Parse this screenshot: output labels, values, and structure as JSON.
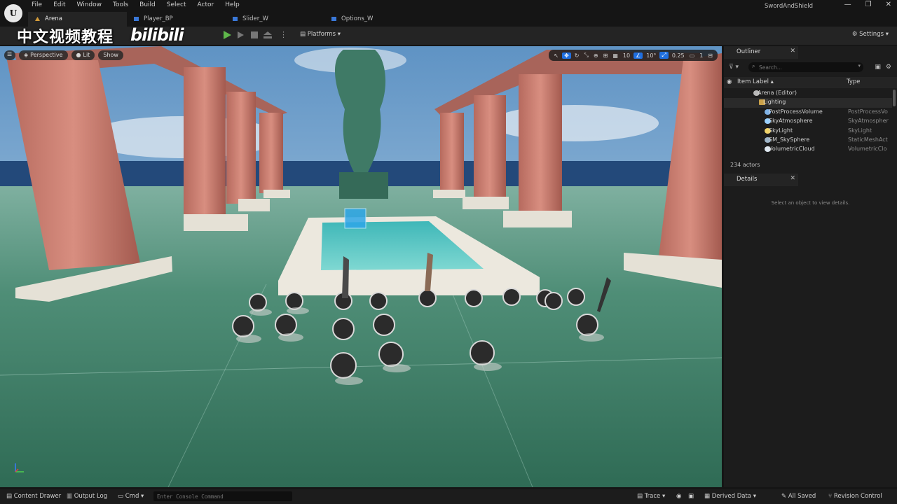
{
  "app": {
    "logo": "U",
    "project_name": "SwordAndShield",
    "window_controls": [
      "—",
      "❐",
      "✕"
    ]
  },
  "menu": [
    "File",
    "Edit",
    "Window",
    "Tools",
    "Build",
    "Select",
    "Actor",
    "Help"
  ],
  "tabs": [
    {
      "label": "Arena",
      "active": true
    },
    {
      "label": "Player_BP",
      "active": false
    },
    {
      "label": "Slider_W",
      "active": false
    },
    {
      "label": "Options_W",
      "active": false
    }
  ],
  "watermark": {
    "text": "中文视频教程",
    "logo": "bilibili"
  },
  "toolbar": {
    "platforms_label": "Platforms",
    "settings_label": "Settings"
  },
  "viewport": {
    "perspective_label": "Perspective",
    "lit_label": "Lit",
    "show_label": "Show",
    "grid_snap": "10",
    "rotation_snap": "10°",
    "scale_snap": "0.25",
    "camera_speed": "1"
  },
  "outliner": {
    "title": "Outliner",
    "search_placeholder": "Search...",
    "col_label": "Item Label ▴",
    "col_type": "Type",
    "rows": [
      {
        "name": "Arena (Editor)",
        "type": "",
        "indent": 44,
        "icon": "world"
      },
      {
        "name": "Lighting",
        "type": "",
        "indent": 52,
        "icon": "folder"
      },
      {
        "name": "PostProcessVolume",
        "type": "PostProcessVo",
        "indent": 60,
        "icon": "volume"
      },
      {
        "name": "SkyAtmosphere",
        "type": "SkyAtmospher",
        "indent": 60,
        "icon": "sky"
      },
      {
        "name": "SkyLight",
        "type": "SkyLight",
        "indent": 60,
        "icon": "light"
      },
      {
        "name": "SM_SkySphere",
        "type": "StaticMeshAct",
        "indent": 60,
        "icon": "mesh"
      },
      {
        "name": "VolumetricCloud",
        "type": "VolumetricClo",
        "indent": 60,
        "icon": "cloud"
      }
    ],
    "actor_count": "234 actors"
  },
  "details": {
    "title": "Details",
    "hint": "Select an object to view details."
  },
  "statusbar": {
    "content_drawer": "Content Drawer",
    "output_log": "Output Log",
    "cmd": "Cmd",
    "console_placeholder": "Enter Console Command",
    "trace": "Trace",
    "derived_data": "Derived Data",
    "all_saved": "All Saved",
    "revision_control": "Revision Control"
  },
  "colors": {
    "accent_blue": "#1f6fe0",
    "play_green": "#5fb74a",
    "panel_bg": "#1c1c1c",
    "toolbar_bg": "#242424"
  }
}
